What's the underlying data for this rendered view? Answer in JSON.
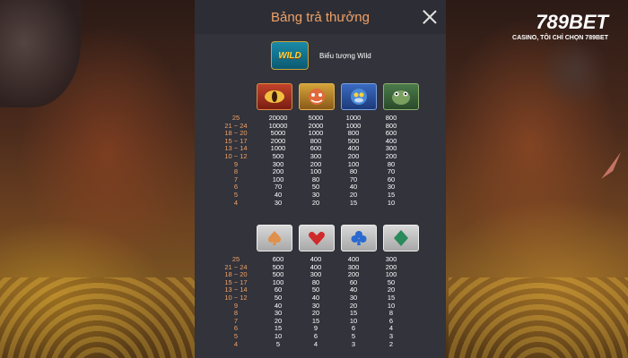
{
  "brand": {
    "name_main": "789",
    "name_accent": "BET",
    "tagline": "CASINO, TÔI CHỈ CHỌN 789BET"
  },
  "panel": {
    "title": "Bảng trả thưởng",
    "wild": {
      "icon_text": "WILD",
      "label": "Biểu tượng Wild"
    }
  },
  "section1": {
    "symbols": [
      "red-dragon-icon",
      "orange-dragon-icon",
      "blue-dragon-icon",
      "green-dragon-icon"
    ],
    "rows": [
      {
        "count": "25",
        "v": [
          "20000",
          "5000",
          "1000",
          "800"
        ]
      },
      {
        "count": "21 ~ 24",
        "v": [
          "10000",
          "2000",
          "1000",
          "800"
        ]
      },
      {
        "count": "18 ~ 20",
        "v": [
          "5000",
          "1000",
          "800",
          "600"
        ]
      },
      {
        "count": "15 ~ 17",
        "v": [
          "2000",
          "800",
          "500",
          "400"
        ]
      },
      {
        "count": "13 ~ 14",
        "v": [
          "1000",
          "600",
          "400",
          "300"
        ]
      },
      {
        "count": "10 ~ 12",
        "v": [
          "500",
          "300",
          "200",
          "200"
        ]
      },
      {
        "count": "9",
        "v": [
          "300",
          "200",
          "100",
          "80"
        ]
      },
      {
        "count": "8",
        "v": [
          "200",
          "100",
          "80",
          "70"
        ]
      },
      {
        "count": "7",
        "v": [
          "100",
          "80",
          "70",
          "60"
        ]
      },
      {
        "count": "6",
        "v": [
          "70",
          "50",
          "40",
          "30"
        ]
      },
      {
        "count": "5",
        "v": [
          "40",
          "30",
          "20",
          "15"
        ]
      },
      {
        "count": "4",
        "v": [
          "30",
          "20",
          "15",
          "10"
        ]
      }
    ]
  },
  "section2": {
    "symbols": [
      "spade-icon",
      "heart-icon",
      "club-icon",
      "diamond-icon"
    ],
    "colors": {
      "spade": "#e0904a",
      "heart": "#d02a2a",
      "club": "#2a6ad0",
      "diamond": "#2a8a5a"
    },
    "rows": [
      {
        "count": "25",
        "v": [
          "600",
          "400",
          "400",
          "300"
        ]
      },
      {
        "count": "21 ~ 24",
        "v": [
          "500",
          "400",
          "300",
          "200"
        ]
      },
      {
        "count": "18 ~ 20",
        "v": [
          "500",
          "300",
          "200",
          "100"
        ]
      },
      {
        "count": "15 ~ 17",
        "v": [
          "100",
          "80",
          "60",
          "50"
        ]
      },
      {
        "count": "13 ~ 14",
        "v": [
          "60",
          "50",
          "40",
          "20"
        ]
      },
      {
        "count": "10 ~ 12",
        "v": [
          "50",
          "40",
          "30",
          "15"
        ]
      },
      {
        "count": "9",
        "v": [
          "40",
          "30",
          "20",
          "10"
        ]
      },
      {
        "count": "8",
        "v": [
          "30",
          "20",
          "15",
          "8"
        ]
      },
      {
        "count": "7",
        "v": [
          "20",
          "15",
          "10",
          "6"
        ]
      },
      {
        "count": "6",
        "v": [
          "15",
          "9",
          "6",
          "4"
        ]
      },
      {
        "count": "5",
        "v": [
          "10",
          "6",
          "5",
          "3"
        ]
      },
      {
        "count": "4",
        "v": [
          "5",
          "4",
          "3",
          "2"
        ]
      }
    ]
  }
}
